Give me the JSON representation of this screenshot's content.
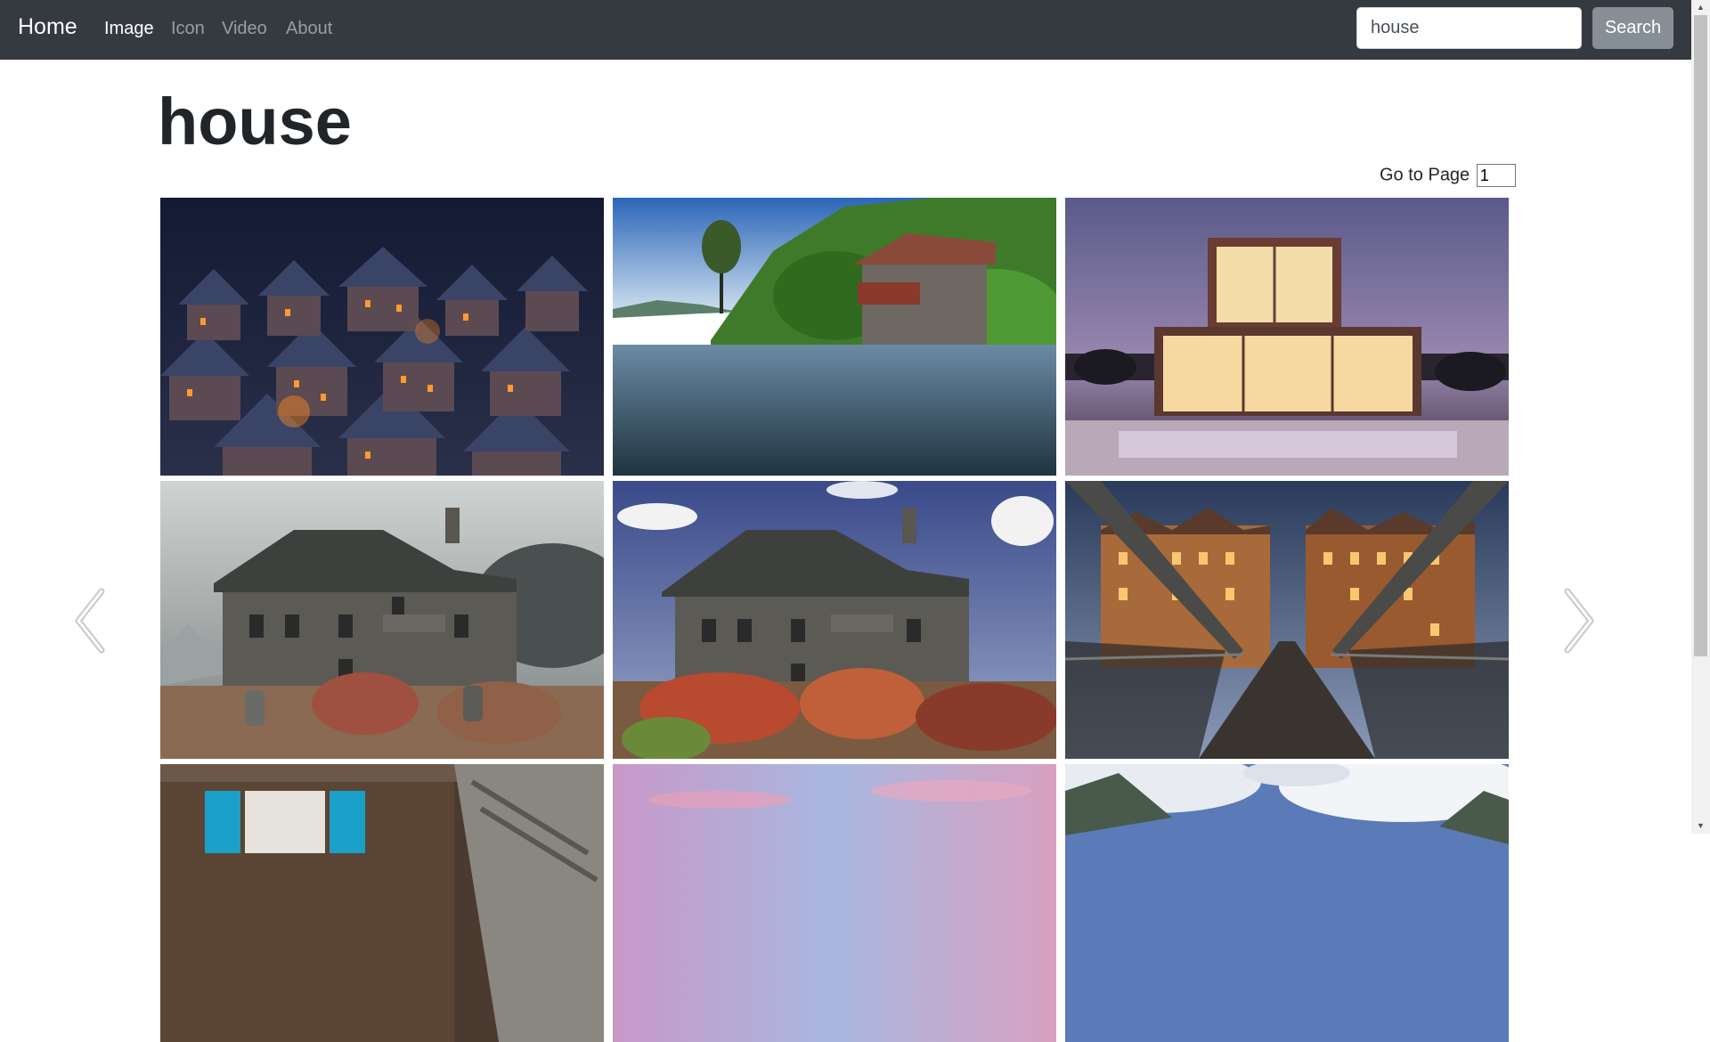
{
  "navbar": {
    "brand": "Home",
    "links": [
      {
        "label": "Image",
        "active": true
      },
      {
        "label": "Icon",
        "active": false
      },
      {
        "label": "Video",
        "active": false
      },
      {
        "label": "About",
        "active": false
      }
    ],
    "search_value": "house",
    "search_button": "Search"
  },
  "main": {
    "title": "house",
    "goto_label": "Go to Page",
    "page_value": "1"
  },
  "gallery": {
    "images": [
      {
        "subject": "snowy village at night"
      },
      {
        "subject": "boathouse on lake"
      },
      {
        "subject": "modern house at dusk"
      },
      {
        "subject": "stone house stormy sky"
      },
      {
        "subject": "stone house blue sky"
      },
      {
        "subject": "bridge to warehouses"
      },
      {
        "subject": "wooden house blue shutters"
      },
      {
        "subject": "pink sunset sky"
      },
      {
        "subject": "mountain clouds"
      }
    ]
  },
  "icons": {
    "prev": "chevron-left-icon",
    "next": "chevron-right-icon"
  },
  "colors": {
    "navbar_bg": "#343a40",
    "search_button_bg": "#868e96"
  }
}
